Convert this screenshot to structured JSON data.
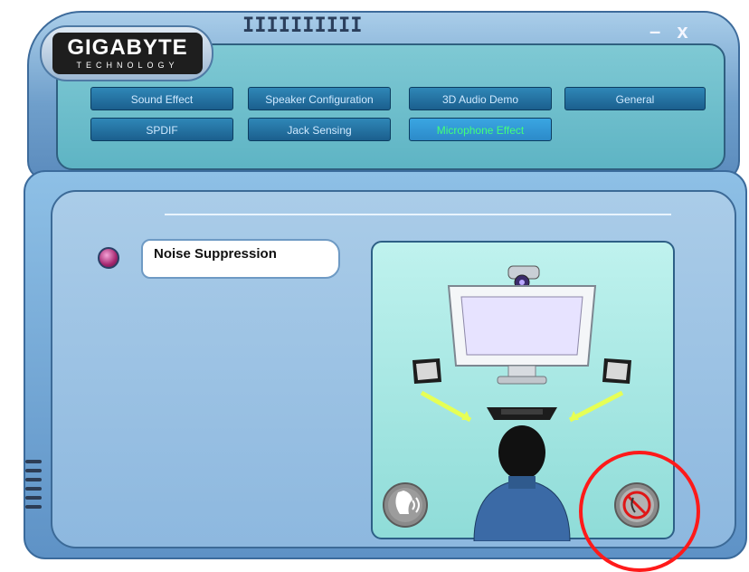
{
  "brand": {
    "name": "GIGABYTE",
    "subtitle": "TECHNOLOGY"
  },
  "window": {
    "minimize": "–",
    "close": "x",
    "grip": "IIIIIIIIII"
  },
  "tabs": [
    {
      "label": "Sound Effect",
      "active": false
    },
    {
      "label": "Speaker Configuration",
      "active": false
    },
    {
      "label": "3D Audio Demo",
      "active": false
    },
    {
      "label": "General",
      "active": false
    },
    {
      "label": "SPDIF",
      "active": false
    },
    {
      "label": "Jack Sensing",
      "active": false
    },
    {
      "label": "Microphone Effect",
      "active": true
    }
  ],
  "effect": {
    "label": "Noise Suppression",
    "enabled": true
  },
  "scene": {
    "left_button_icon": "voice-icon",
    "right_button_icon": "mute-voice-icon"
  },
  "colors": {
    "accent_active_text": "#43ff7a",
    "highlight": "#ff1a1a",
    "tab_bg": "#1b5f8e"
  }
}
